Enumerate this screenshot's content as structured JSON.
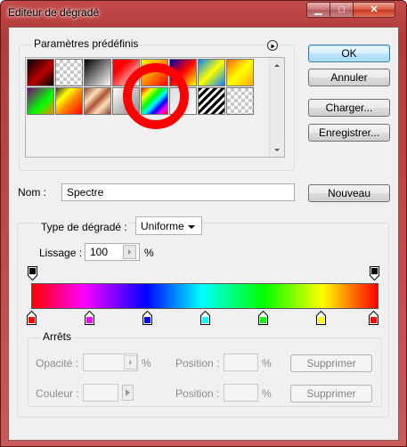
{
  "window": {
    "title": "Editeur de dégradé"
  },
  "presets": {
    "label": "Paramètres prédéfinis",
    "swatches": [
      {
        "css": "linear-gradient(135deg,#000 0%,#b80000 55%,#000 100%)"
      },
      {
        "css": "linear-gradient(135deg,#000,#777)"
      },
      {
        "css": "linear-gradient(135deg,#000 0%,#fff 100%)"
      },
      {
        "css": "linear-gradient(135deg,#f00 0%,#f00 30%,#fff 100%)"
      },
      {
        "css": "linear-gradient(135deg,#ff0 0%,#f80 50%,#f00 100%)"
      },
      {
        "css": "linear-gradient(135deg,#00a 0%,#f00 50%,#ff0 100%)"
      },
      {
        "css": "linear-gradient(135deg,#0080ff 0%,#ff0 50%,#0080ff 100%)"
      },
      {
        "css": "linear-gradient(135deg,#f60 0%,#ff0 50%,#fa0 100%)"
      },
      {
        "css": "linear-gradient(135deg,#800080 0%,#0f0 60%,#f80 100%)"
      },
      {
        "css": "linear-gradient(135deg,#333 0%,#ff0 30%,#f80 55%,#f00 100%)"
      },
      {
        "css": "linear-gradient(135deg,#843 0%,#fdb 30%,#a53 50%,#fdb 70%,#843 100%)"
      },
      {
        "css": "linear-gradient(135deg,#fff,#888)"
      },
      {
        "css": "linear-gradient(135deg,#f00 0%,#ff0 20%,#0f0 40%,#0ff 55%,#00f 70%,#f0f 85%,#f00 100%)"
      },
      {
        "css": "linear-gradient(135deg,#ddd,#fff)"
      },
      {
        "css": "repeating-linear-gradient(135deg,#000 0 3px,#fff 3px 6px)"
      },
      {
        "css": "transparent"
      }
    ]
  },
  "buttons": {
    "ok": "OK",
    "cancel": "Annuler",
    "load": "Charger...",
    "save": "Enregistrer...",
    "new": "Nouveau"
  },
  "name": {
    "label": "Nom :",
    "value": "Spectre"
  },
  "gradient": {
    "type_label": "Type de dégradé :",
    "type_value": "Uniforme",
    "smoothness_label": "Lissage :",
    "smoothness_value": "100",
    "smoothness_unit": "%",
    "color_stops": [
      "#ff0000",
      "#ff00ff",
      "#0000ff",
      "#00ffff",
      "#00ff00",
      "#ffff00",
      "#ff0000"
    ],
    "bar_css": "linear-gradient(90deg,#ff0000 0%,#ff00ff 15%,#0000ff 33%,#00ffff 49%,#00ff00 67%,#ffff00 84%,#ff0000 100%)"
  },
  "stops": {
    "label": "Arrêts",
    "opacity_label": "Opacité :",
    "percent": "%",
    "position_label": "Position :",
    "color_label": "Couleur :",
    "delete": "Supprimer"
  }
}
